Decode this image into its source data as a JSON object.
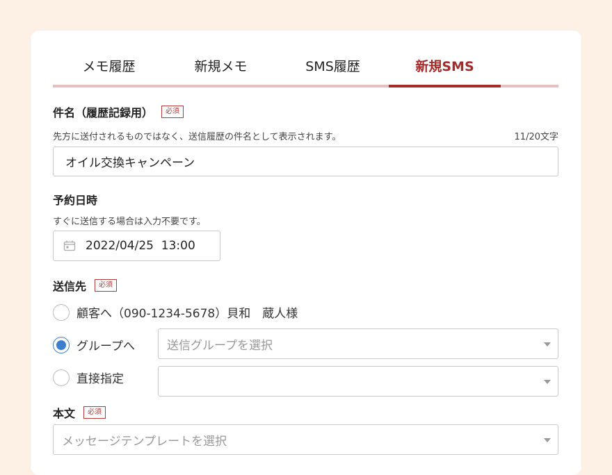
{
  "tabs": [
    {
      "label": "メモ履歴"
    },
    {
      "label": "新規メモ"
    },
    {
      "label": "SMS履歴"
    },
    {
      "label": "新規SMS",
      "active": true
    }
  ],
  "subject": {
    "label": "件名（履歴記録用）",
    "required": "必須",
    "help": "先方に送付されるものではなく、送信履歴の件名として表示されます。",
    "counter": "11/20文字",
    "value": "オイル交換キャンペーン"
  },
  "schedule": {
    "label": "予約日時",
    "help": "すぐに送信する場合は入力不要です。",
    "value": "2022/04/25  13:00",
    "icon": "calendar-icon"
  },
  "recipient": {
    "label": "送信先",
    "required": "必須",
    "options": [
      {
        "label": "顧客へ（090-1234-5678）貝和　蔵人様",
        "checked": false
      },
      {
        "label": "グループへ",
        "checked": true
      },
      {
        "label": "直接指定",
        "checked": false
      }
    ],
    "group_placeholder": "送信グループを選択",
    "direct_value": ""
  },
  "body": {
    "label": "本文",
    "required": "必須",
    "template_placeholder": "メッセージテンプレートを選択"
  },
  "colors": {
    "accent": "#a52a2a",
    "tab_underline": "#e6c0c0",
    "radio_checked": "#3d7fce",
    "page_bg": "#fdf1e6"
  }
}
